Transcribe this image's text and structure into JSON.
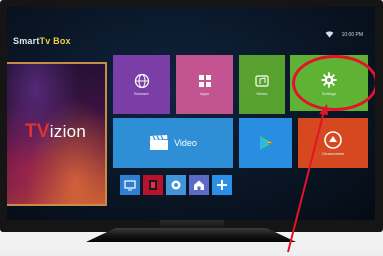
{
  "screen": {
    "brand_main": "Smart",
    "brand_accent": "Tv Box",
    "clock": "10:00 PM"
  },
  "poster": {
    "logo_mark": "TV",
    "logo_text": "izion"
  },
  "tiles": {
    "browser": {
      "label": "Browser"
    },
    "apps": {
      "label": "Apps"
    },
    "media": {
      "label": "Media"
    },
    "settings": {
      "label": "Settings"
    },
    "video": {
      "label": "Video"
    },
    "play": {
      "label": ""
    },
    "cleaner": {
      "label": "Cleanmaster"
    }
  },
  "icons": {
    "wifi": "wifi-icon",
    "settings": "gear-icon",
    "browser": "globe-icon",
    "apps": "grid-icon",
    "media": "music-icon",
    "video": "clapperboard-icon",
    "play": "play-store-icon",
    "cleaner": "broom-icon",
    "add": "plus-icon"
  },
  "annotation": {
    "circle_color": "#e3132a",
    "arrow_color": "#e3132a"
  }
}
